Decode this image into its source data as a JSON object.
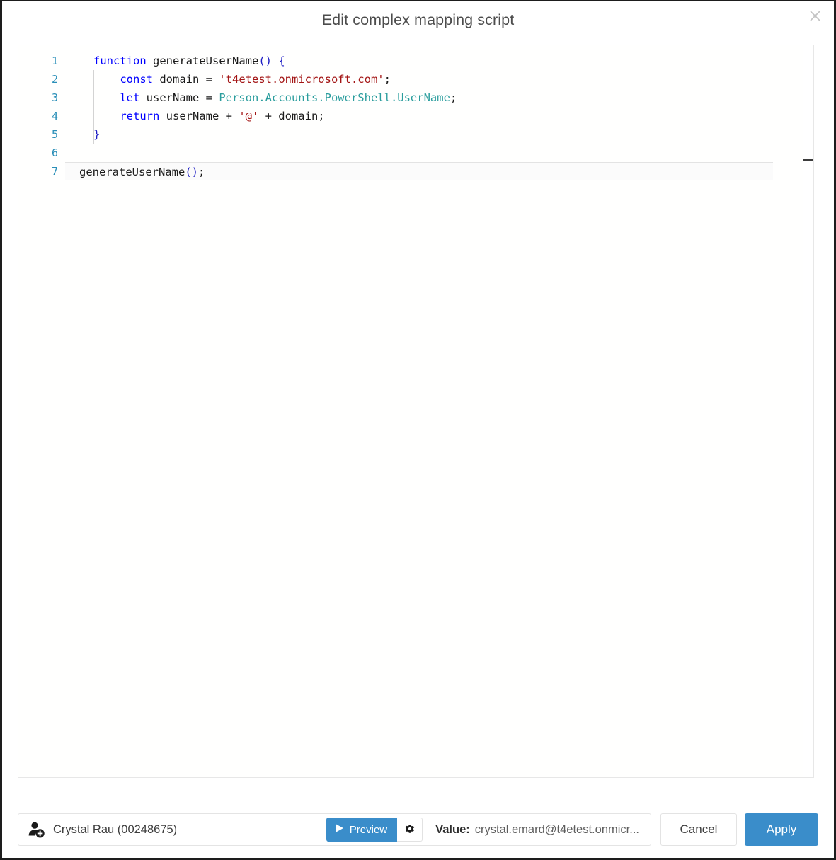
{
  "dialog": {
    "title": "Edit complex mapping script",
    "close_icon": "close-icon"
  },
  "editor": {
    "line_numbers": [
      "1",
      "2",
      "3",
      "4",
      "5",
      "6",
      "7"
    ],
    "active_line": 7,
    "lines": [
      {
        "n": "1",
        "tokens": [
          {
            "t": "function",
            "c": "kw"
          },
          {
            "t": " ",
            "c": "plain"
          },
          {
            "t": "generateUserName",
            "c": "plain"
          },
          {
            "t": "()",
            "c": "punc"
          },
          {
            "t": " ",
            "c": "plain"
          },
          {
            "t": "{",
            "c": "punc"
          }
        ]
      },
      {
        "n": "2",
        "tokens": [
          {
            "t": "    ",
            "c": "plain"
          },
          {
            "t": "const",
            "c": "kw"
          },
          {
            "t": " domain = ",
            "c": "plain"
          },
          {
            "t": "'t4etest.onmicrosoft.com'",
            "c": "str"
          },
          {
            "t": ";",
            "c": "plain"
          }
        ]
      },
      {
        "n": "3",
        "tokens": [
          {
            "t": "    ",
            "c": "plain"
          },
          {
            "t": "let",
            "c": "kw"
          },
          {
            "t": " userName = ",
            "c": "plain"
          },
          {
            "t": "Person.Accounts.PowerShell.UserName",
            "c": "ident"
          },
          {
            "t": ";",
            "c": "plain"
          }
        ]
      },
      {
        "n": "4",
        "tokens": [
          {
            "t": "    ",
            "c": "plain"
          },
          {
            "t": "return",
            "c": "kw"
          },
          {
            "t": " userName + ",
            "c": "plain"
          },
          {
            "t": "'@'",
            "c": "str"
          },
          {
            "t": " + domain;",
            "c": "plain"
          }
        ]
      },
      {
        "n": "5",
        "tokens": [
          {
            "t": "}",
            "c": "punc"
          }
        ]
      },
      {
        "n": "6",
        "tokens": []
      },
      {
        "n": "7",
        "tokens": [
          {
            "t": "generateUserName",
            "c": "plain"
          },
          {
            "t": "()",
            "c": "punc"
          },
          {
            "t": ";",
            "c": "plain"
          }
        ]
      }
    ],
    "code_text": "function generateUserName() {\n    const domain = 't4etest.onmicrosoft.com';\n    let userName = Person.Accounts.PowerShell.UserName;\n    return userName + '@' + domain;\n}\n\ngenerateUserName();"
  },
  "bottom_bar": {
    "person_icon": "user-add-icon",
    "person_label": "Crystal Rau (00248675)",
    "preview_label": "Preview",
    "preview_icon": "play-icon",
    "settings_icon": "gear-icon",
    "value_label": "Value:",
    "value_text": "crystal.emard@t4etest.onmicr...",
    "cancel_label": "Cancel",
    "apply_label": "Apply"
  },
  "colors": {
    "accent_blue": "#3a8dca",
    "keyword": "#0000ff",
    "string": "#a31515",
    "identifier": "#2a9d9d",
    "line_number": "#2a8fb8",
    "title_text": "#4c4c4c"
  }
}
